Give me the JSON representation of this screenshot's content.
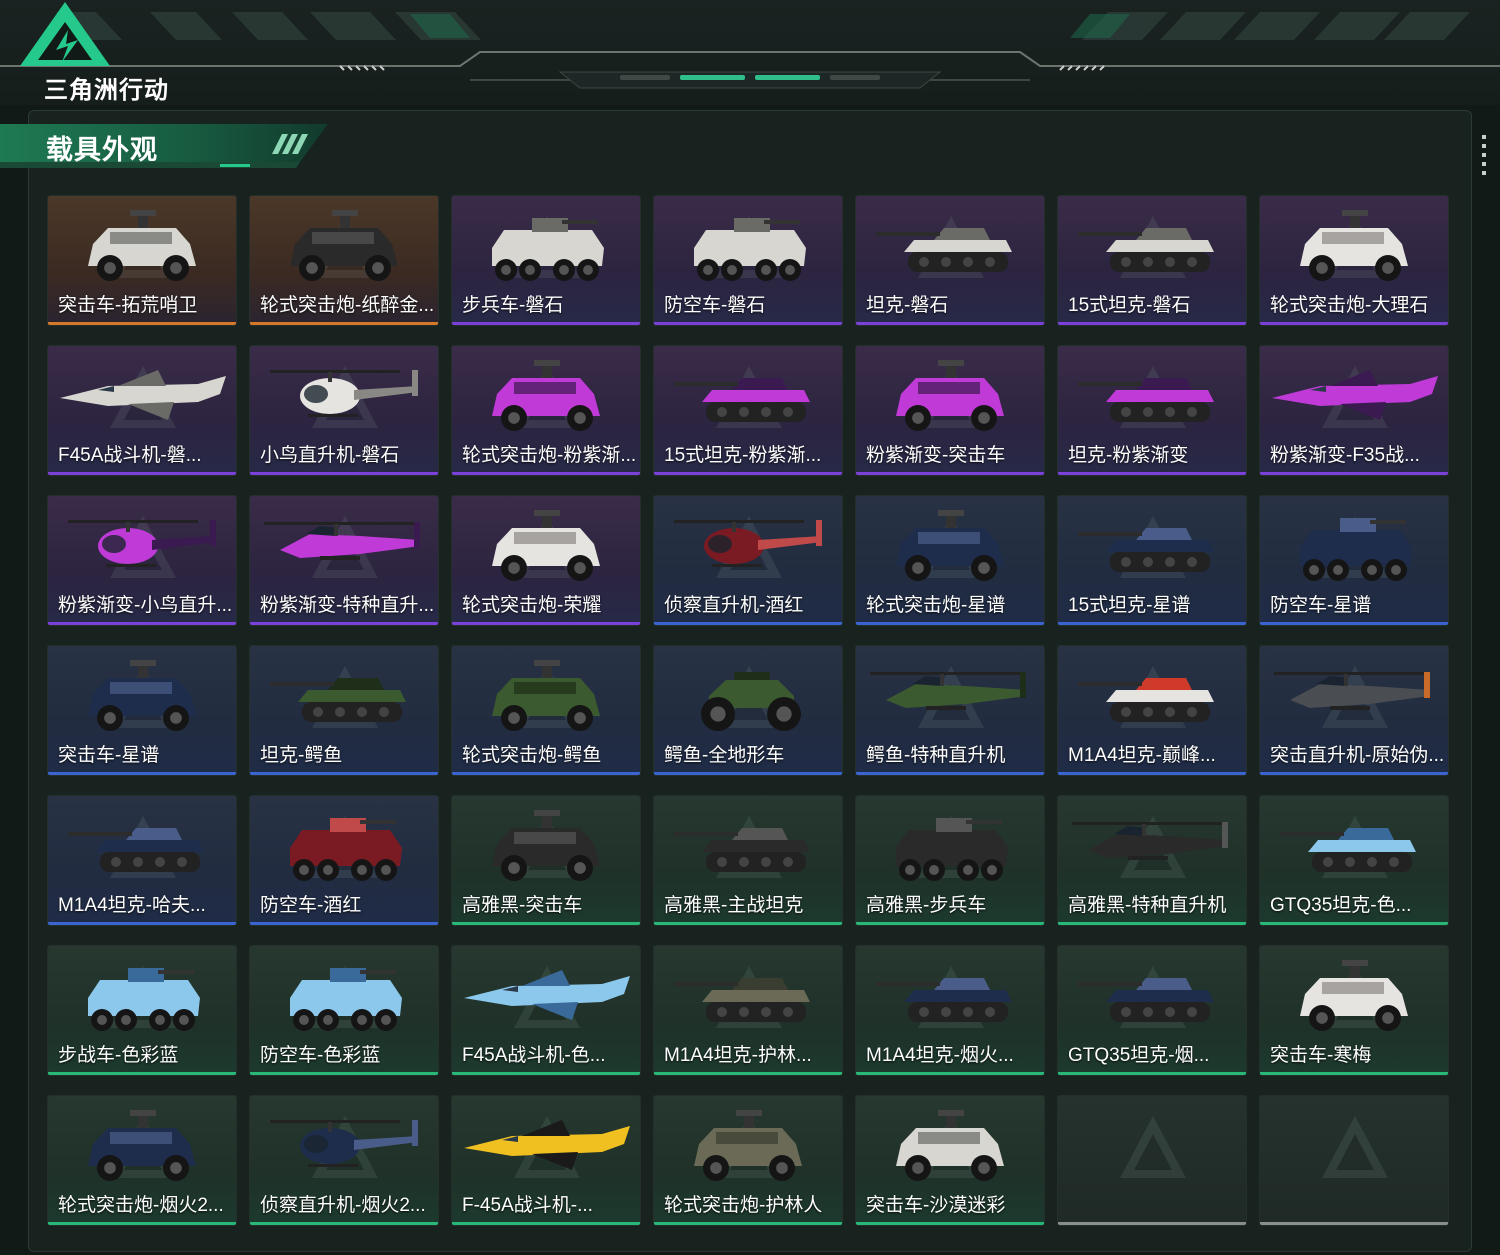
{
  "app": {
    "logo_text": "三角洲行动"
  },
  "section": {
    "title": "载具外观"
  },
  "colors": {
    "orange": "#d6782a",
    "purple": "#7a40d8",
    "blue": "#3a64d0",
    "green": "#28b878",
    "empty": "#8a8f8d"
  },
  "items": [
    {
      "label": "突击车-拓荒哨卫",
      "rarity": "orange",
      "kind": "car",
      "paint": "snow"
    },
    {
      "label": "轮式突击炮-纸醉金...",
      "rarity": "orange",
      "kind": "car",
      "paint": "black"
    },
    {
      "label": "步兵车-磐石",
      "rarity": "purple",
      "kind": "apc",
      "paint": "snow"
    },
    {
      "label": "防空车-磐石",
      "rarity": "purple",
      "kind": "apc",
      "paint": "snow"
    },
    {
      "label": "坦克-磐石",
      "rarity": "purple",
      "kind": "tank",
      "paint": "snow"
    },
    {
      "label": "15式坦克-磐石",
      "rarity": "purple",
      "kind": "tank",
      "paint": "snow"
    },
    {
      "label": "轮式突击炮-大理石",
      "rarity": "purple",
      "kind": "car",
      "paint": "white"
    },
    {
      "label": "F45A战斗机-磐...",
      "rarity": "purple",
      "kind": "jet",
      "paint": "snow"
    },
    {
      "label": "小鸟直升机-磐石",
      "rarity": "purple",
      "kind": "heli",
      "paint": "white"
    },
    {
      "label": "轮式突击炮-粉紫渐...",
      "rarity": "purple",
      "kind": "car",
      "paint": "pink"
    },
    {
      "label": "15式坦克-粉紫渐...",
      "rarity": "purple",
      "kind": "tank",
      "paint": "pink"
    },
    {
      "label": "粉紫渐变-突击车",
      "rarity": "purple",
      "kind": "car",
      "paint": "pink"
    },
    {
      "label": "坦克-粉紫渐变",
      "rarity": "purple",
      "kind": "tank",
      "paint": "pink"
    },
    {
      "label": "粉紫渐变-F35战...",
      "rarity": "purple",
      "kind": "jet",
      "paint": "pink"
    },
    {
      "label": "粉紫渐变-小鸟直升...",
      "rarity": "purple",
      "kind": "heli",
      "paint": "pink"
    },
    {
      "label": "粉紫渐变-特种直升...",
      "rarity": "purple",
      "kind": "attack",
      "paint": "pink"
    },
    {
      "label": "轮式突击炮-荣耀",
      "rarity": "purple",
      "kind": "car",
      "paint": "white"
    },
    {
      "label": "侦察直升机-酒红",
      "rarity": "blue",
      "kind": "heli",
      "paint": "red"
    },
    {
      "label": "轮式突击炮-星谱",
      "rarity": "blue",
      "kind": "car",
      "paint": "navy"
    },
    {
      "label": "15式坦克-星谱",
      "rarity": "blue",
      "kind": "tank",
      "paint": "navy"
    },
    {
      "label": "防空车-星谱",
      "rarity": "blue",
      "kind": "apc",
      "paint": "navy"
    },
    {
      "label": "突击车-星谱",
      "rarity": "blue",
      "kind": "car",
      "paint": "navy"
    },
    {
      "label": "坦克-鳄鱼",
      "rarity": "blue",
      "kind": "tank",
      "paint": "green"
    },
    {
      "label": "轮式突击炮-鳄鱼",
      "rarity": "blue",
      "kind": "car",
      "paint": "green"
    },
    {
      "label": "鳄鱼-全地形车",
      "rarity": "blue",
      "kind": "atv",
      "paint": "green"
    },
    {
      "label": "鳄鱼-特种直升机",
      "rarity": "blue",
      "kind": "attack",
      "paint": "green"
    },
    {
      "label": "M1A4坦克-巅峰...",
      "rarity": "blue",
      "kind": "tank",
      "paint": "redwhite"
    },
    {
      "label": "突击直升机-原始伪...",
      "rarity": "blue",
      "kind": "attack",
      "paint": "grey"
    },
    {
      "label": "M1A4坦克-哈夫...",
      "rarity": "blue",
      "kind": "tank",
      "paint": "navy"
    },
    {
      "label": "防空车-酒红",
      "rarity": "blue",
      "kind": "apc",
      "paint": "red"
    },
    {
      "label": "高雅黑-突击车",
      "rarity": "green",
      "kind": "car",
      "paint": "black"
    },
    {
      "label": "高雅黑-主战坦克",
      "rarity": "green",
      "kind": "tank",
      "paint": "black"
    },
    {
      "label": "高雅黑-步兵车",
      "rarity": "green",
      "kind": "apc",
      "paint": "black"
    },
    {
      "label": "高雅黑-特种直升机",
      "rarity": "green",
      "kind": "attack",
      "paint": "black"
    },
    {
      "label": "GTQ35坦克-色...",
      "rarity": "green",
      "kind": "tank",
      "paint": "lightblue"
    },
    {
      "label": "步战车-色彩蓝",
      "rarity": "green",
      "kind": "apc",
      "paint": "lightblue"
    },
    {
      "label": "防空车-色彩蓝",
      "rarity": "green",
      "kind": "apc",
      "paint": "lightblue"
    },
    {
      "label": "F45A战斗机-色...",
      "rarity": "green",
      "kind": "jet",
      "paint": "lightblue"
    },
    {
      "label": "M1A4坦克-护林...",
      "rarity": "green",
      "kind": "tank",
      "paint": "camo"
    },
    {
      "label": "M1A4坦克-烟火...",
      "rarity": "green",
      "kind": "tank",
      "paint": "navy"
    },
    {
      "label": "GTQ35坦克-烟...",
      "rarity": "green",
      "kind": "tank",
      "paint": "navy"
    },
    {
      "label": "突击车-寒梅",
      "rarity": "green",
      "kind": "car",
      "paint": "white"
    },
    {
      "label": "轮式突击炮-烟火2...",
      "rarity": "green",
      "kind": "car",
      "paint": "navy"
    },
    {
      "label": "侦察直升机-烟火2...",
      "rarity": "green",
      "kind": "heli",
      "paint": "navy"
    },
    {
      "label": "F-45A战斗机-...",
      "rarity": "green",
      "kind": "jet",
      "paint": "yellow"
    },
    {
      "label": "轮式突击炮-护林人",
      "rarity": "green",
      "kind": "car",
      "paint": "camo"
    },
    {
      "label": "突击车-沙漠迷彩",
      "rarity": "green",
      "kind": "car",
      "paint": "snow"
    },
    {
      "label": "",
      "rarity": "empty",
      "kind": "empty",
      "paint": "none"
    },
    {
      "label": "",
      "rarity": "empty",
      "kind": "empty",
      "paint": "none"
    }
  ]
}
